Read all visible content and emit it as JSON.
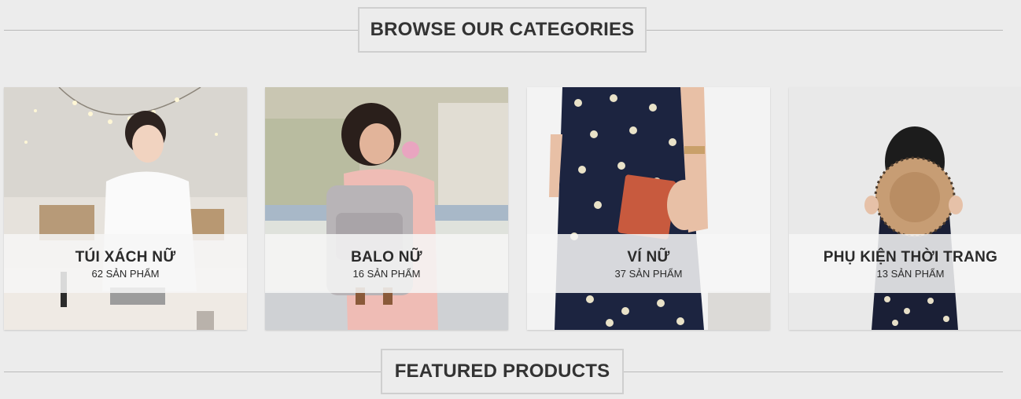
{
  "sections": {
    "browse_title": "BROWSE OUR CATEGORIES",
    "featured_title": "FEATURED PRODUCTS"
  },
  "categories": [
    {
      "name": "TÚI XÁCH NỮ",
      "count": "62 SẢN PHẨM"
    },
    {
      "name": "BALO NỮ",
      "count": "16 SẢN PHẨM"
    },
    {
      "name": "VÍ NỮ",
      "count": "37 SẢN PHẨM"
    },
    {
      "name": "PHỤ KIỆN THỜI TRANG",
      "count": "13 SẢN PHẨM"
    }
  ],
  "colors": {
    "background": "#ececec",
    "heading_border": "#cfcfcf",
    "rule": "#b9b9b9",
    "overlay": "#f6f6f6",
    "text": "#2a2a2a"
  }
}
